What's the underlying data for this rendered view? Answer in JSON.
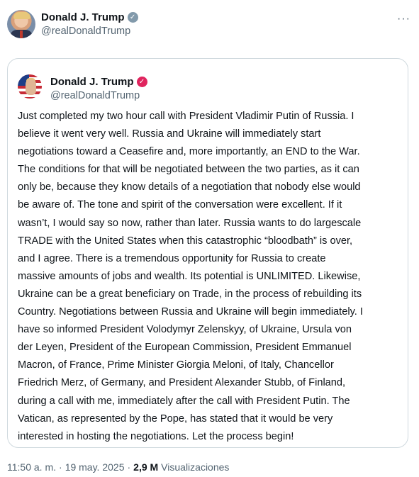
{
  "post": {
    "author": {
      "name": "Donald J. Trump",
      "handle": "@realDonaldTrump",
      "verified_icon": "check-badge-icon"
    },
    "more_icon": "more-dots-icon",
    "quoted": {
      "author": {
        "name": "Donald J. Trump",
        "handle": "@realDonaldTrump",
        "verified_icon": "check-badge-icon"
      },
      "text": "Just completed my two hour call with President Vladimir Putin of Russia. I\nbelieve it went very well. Russia and Ukraine will immediately start\nnegotiations toward a Ceasefire and, more importantly, an END to the War.\nThe conditions for that will be negotiated between the two parties, as it can\nonly be, because they know details of a negotiation that nobody else would\nbe aware of. The tone and spirit of the conversation were excellent. If it\nwasn’t, I would say so now, rather than later. Russia wants to do largescale\nTRADE with the United States when this catastrophic “bloodbath” is over,\nand I agree. There is a tremendous opportunity for Russia to create\nmassive amounts of jobs and wealth. Its potential is UNLIMITED. Likewise,\nUkraine can be a great beneficiary on Trade, in the process of rebuilding its\nCountry. Negotiations between Russia and Ukraine will begin immediately. I\nhave so informed President Volodymyr Zelenskyy, of Ukraine, Ursula von\nder Leyen, President of the European Commission, President Emmanuel\nMacron, of France, Prime Minister Giorgia Meloni, of Italy, Chancellor\nFriedrich Merz, of Germany, and President Alexander Stubb, of Finland,\nduring a call with me, immediately after the call with President Putin. The\nVatican, as represented by the Pope, has stated that it would be very\ninterested in hosting the negotiations. Let the process begin!"
    },
    "meta": {
      "time": "11:50 a. m.",
      "separator": "·",
      "date": "19 may. 2025",
      "views_count": "2,9 M",
      "views_label": "Visualizaciones"
    }
  },
  "colors": {
    "text_primary": "#0f1419",
    "text_secondary": "#536471",
    "border": "#cfd9de",
    "verified_gray": "#829aab",
    "verified_red": "#e0245e"
  }
}
